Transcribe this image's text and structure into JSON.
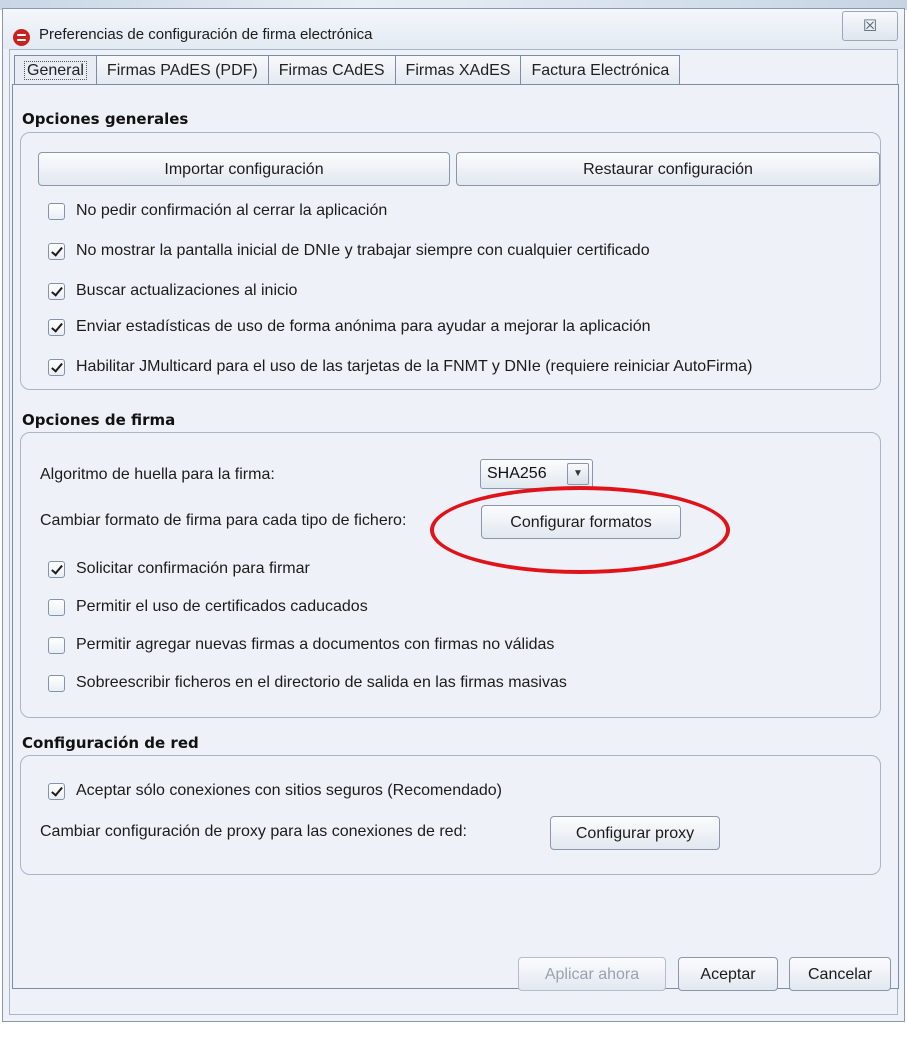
{
  "window": {
    "title": "Preferencias de configuración de firma electrónica",
    "close_symbol": "☒"
  },
  "tabs": [
    {
      "label": "General",
      "active": true
    },
    {
      "label": "Firmas PAdES (PDF)",
      "active": false
    },
    {
      "label": "Firmas CAdES",
      "active": false
    },
    {
      "label": "Firmas XAdES",
      "active": false
    },
    {
      "label": "Factura Electrónica",
      "active": false
    }
  ],
  "general": {
    "title": "Opciones generales",
    "import_button": "Importar configuración",
    "restore_button": "Restaurar configuración",
    "options": [
      {
        "label": "No pedir confirmación al cerrar la aplicación",
        "checked": false
      },
      {
        "label": "No mostrar la pantalla inicial de DNIe y trabajar siempre con cualquier certificado",
        "checked": true
      },
      {
        "label": "Buscar actualizaciones al inicio",
        "checked": true
      },
      {
        "label": "Enviar estadísticas de uso de forma anónima para ayudar a mejorar la aplicación",
        "checked": true
      },
      {
        "label": "Habilitar JMulticard para el uso de las tarjetas de la FNMT y DNIe (requiere reiniciar AutoFirma)",
        "checked": true
      }
    ]
  },
  "firma": {
    "title": "Opciones de firma",
    "algorithm_label": "Algoritmo de huella para la firma:",
    "algorithm_value": "SHA256",
    "format_label": "Cambiar formato de firma para cada tipo de fichero:",
    "format_button": "Configurar formatos",
    "options": [
      {
        "label": "Solicitar confirmación para firmar",
        "checked": true
      },
      {
        "label": "Permitir el uso de certificados caducados",
        "checked": false
      },
      {
        "label": "Permitir agregar nuevas firmas a documentos con firmas no válidas",
        "checked": false
      },
      {
        "label": "Sobreescribir ficheros en el directorio de salida en las firmas masivas",
        "checked": false
      }
    ]
  },
  "red": {
    "title": "Configuración de red",
    "option": {
      "label": "Aceptar sólo conexiones con sitios seguros (Recomendado)",
      "checked": true
    },
    "proxy_label": "Cambiar configuración de proxy para las conexiones de red:",
    "proxy_button": "Configurar proxy"
  },
  "footer": {
    "apply": "Aplicar ahora",
    "accept": "Aceptar",
    "cancel": "Cancelar"
  },
  "colors": {
    "highlight": "#e0131a",
    "app_icon": "#c8211e"
  }
}
